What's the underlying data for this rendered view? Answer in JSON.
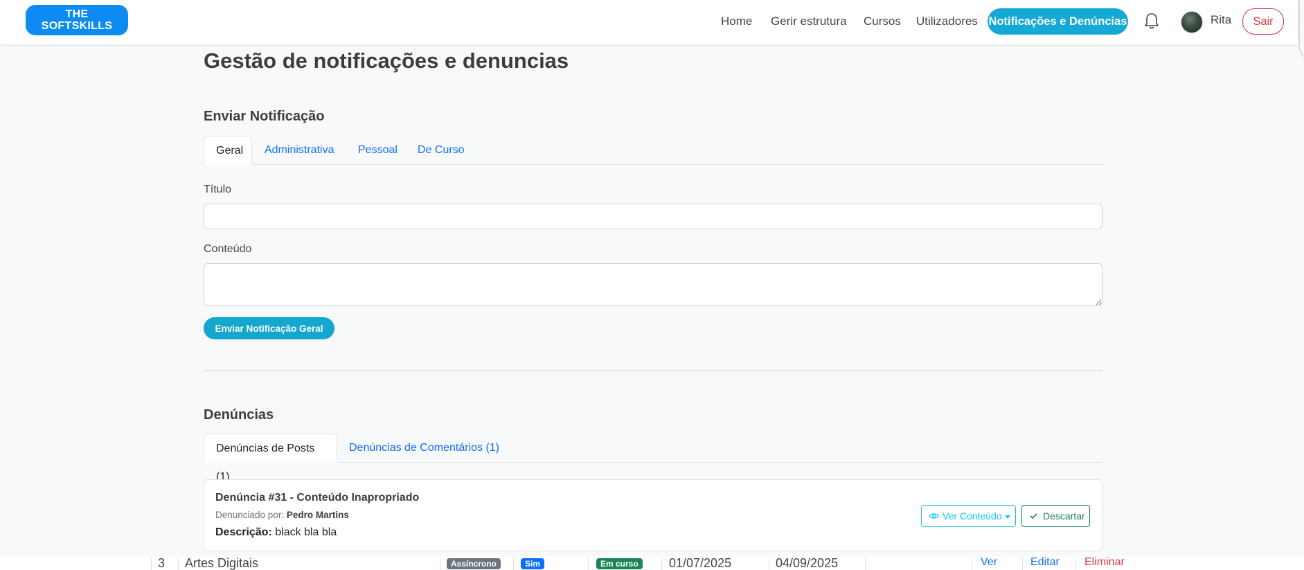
{
  "brand": {
    "logo_line1": "THE",
    "logo_line2": "SOFTSKILLS"
  },
  "nav": {
    "home": "Home",
    "structure": "Gerir estrutura",
    "courses": "Cursos",
    "users": "Utilizadores",
    "notifications": "Notificações e Denúncias",
    "user_name": "Rita",
    "logout": "Sair"
  },
  "page": {
    "title": "Gestão de notificações e denuncias"
  },
  "send_notification": {
    "title": "Enviar Notificação",
    "tabs": [
      "Geral",
      "Administrativa",
      "Pessoal",
      "De Curso"
    ],
    "active_tab": "Geral",
    "title_label": "Título",
    "title_value": "",
    "content_label": "Conteúdo",
    "content_value": "",
    "submit_label": "Enviar Notificação Geral"
  },
  "reports": {
    "title": "Denúncias",
    "tabs": [
      "Denúncias de Posts (1)",
      "Denúncias de Comentários (1)"
    ],
    "active_tab": "Denúncias de Posts (1)",
    "items": [
      {
        "title": "Denúncia #31 - Conteúdo Inapropriado",
        "reported_by_label": "Denunciado por:",
        "reported_by": "Pedro Martins",
        "description_label": "Descrição:",
        "description": "black bla bla",
        "view_label": "Ver Conteúdo",
        "discard_label": "Descartar"
      }
    ]
  },
  "background_row": {
    "id": "3",
    "name": "Artes Digitais",
    "type": "Assíncrono",
    "flag": "Sim",
    "status": "Em curso",
    "start": "01/07/2025",
    "end": "04/09/2025",
    "view": "Ver",
    "edit": "Editar",
    "delete": "Eliminar"
  },
  "colors": {
    "primary": "#0d6efd",
    "accent": "#14a9d6",
    "danger": "#dc3545",
    "success": "#198754",
    "info": "#0dcaf0",
    "logo": "#0d8bf2"
  }
}
